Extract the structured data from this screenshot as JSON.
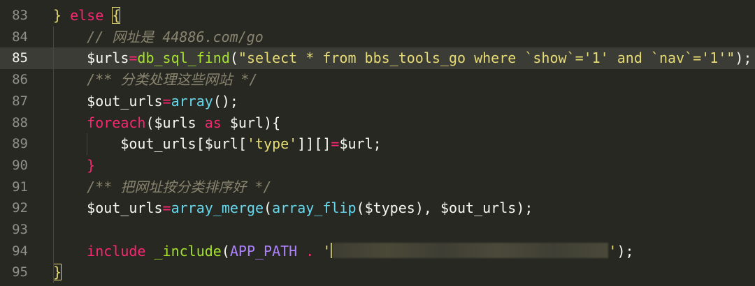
{
  "editor": {
    "lines": [
      {
        "num": "83",
        "tokens": [
          [
            "brace",
            "}"
          ],
          [
            "punc",
            " "
          ],
          [
            "kw",
            "else"
          ],
          [
            "punc",
            " "
          ],
          [
            "brace",
            "{"
          ]
        ]
      },
      {
        "num": "84",
        "tokens": [
          [
            "cm",
            "    // 网址是 44886.com/go"
          ]
        ]
      },
      {
        "num": "85",
        "current": true,
        "tokens": [
          [
            "var",
            "    $urls"
          ],
          [
            "op",
            "="
          ],
          [
            "fn",
            "db_sql_find"
          ],
          [
            "punc",
            "("
          ],
          [
            "str",
            "\"select * from bbs_tools_go where `show`='1' and `nav`='1'\""
          ],
          [
            "punc",
            ");"
          ]
        ]
      },
      {
        "num": "86",
        "tokens": [
          [
            "cm",
            "    /** 分类处理这些网站 */"
          ]
        ]
      },
      {
        "num": "87",
        "tokens": [
          [
            "var",
            "    $out_urls"
          ],
          [
            "op",
            "="
          ],
          [
            "builtin",
            "array"
          ],
          [
            "punc",
            "();"
          ]
        ]
      },
      {
        "num": "88",
        "tokens": [
          [
            "kw",
            "    foreach"
          ],
          [
            "punc",
            "("
          ],
          [
            "var",
            "$urls "
          ],
          [
            "kw",
            "as"
          ],
          [
            "var",
            " $url"
          ],
          [
            "punc",
            "){"
          ]
        ]
      },
      {
        "num": "89",
        "tokens": [
          [
            "var",
            "        $out_urls"
          ],
          [
            "punc",
            "["
          ],
          [
            "var",
            "$url"
          ],
          [
            "punc",
            "["
          ],
          [
            "str",
            "'type'"
          ],
          [
            "punc",
            "]"
          ],
          [
            "punc",
            "]"
          ],
          [
            "punc",
            "[]"
          ],
          [
            "op",
            "="
          ],
          [
            "var",
            "$url"
          ],
          [
            "punc",
            ";"
          ]
        ]
      },
      {
        "num": "90",
        "tokens": [
          [
            "kw",
            "    }"
          ]
        ]
      },
      {
        "num": "91",
        "tokens": [
          [
            "cm",
            "    /** 把网址按分类排序好 */"
          ]
        ]
      },
      {
        "num": "92",
        "tokens": [
          [
            "var",
            "    $out_urls"
          ],
          [
            "op",
            "="
          ],
          [
            "builtin",
            "array_merge"
          ],
          [
            "punc",
            "("
          ],
          [
            "builtin",
            "array_flip"
          ],
          [
            "punc",
            "("
          ],
          [
            "var",
            "$types"
          ],
          [
            "punc",
            "), "
          ],
          [
            "var",
            "$out_urls"
          ],
          [
            "punc",
            ");"
          ]
        ]
      },
      {
        "num": "93",
        "tokens": []
      },
      {
        "num": "94",
        "redacted": true,
        "tokens": [
          [
            "kw",
            "    include"
          ],
          [
            "punc",
            " "
          ],
          [
            "fn",
            "_include"
          ],
          [
            "punc",
            "("
          ],
          [
            "const",
            "APP_PATH"
          ],
          [
            "punc",
            " "
          ],
          [
            "op",
            "."
          ],
          [
            "punc",
            " "
          ],
          [
            "str",
            "'"
          ]
        ],
        "tail": [
          [
            "str",
            "'"
          ],
          [
            "punc",
            ");"
          ]
        ]
      },
      {
        "num": "95",
        "tokens": [
          [
            "brace",
            "}"
          ]
        ]
      }
    ]
  },
  "colors": {
    "background": "#272822",
    "current_line": "#3b3c35",
    "keyword": "#f92672",
    "function": "#a6e22e",
    "string": "#e6db74",
    "comment": "#88846f",
    "builtin": "#66d9ef",
    "constant": "#ae81ff"
  }
}
